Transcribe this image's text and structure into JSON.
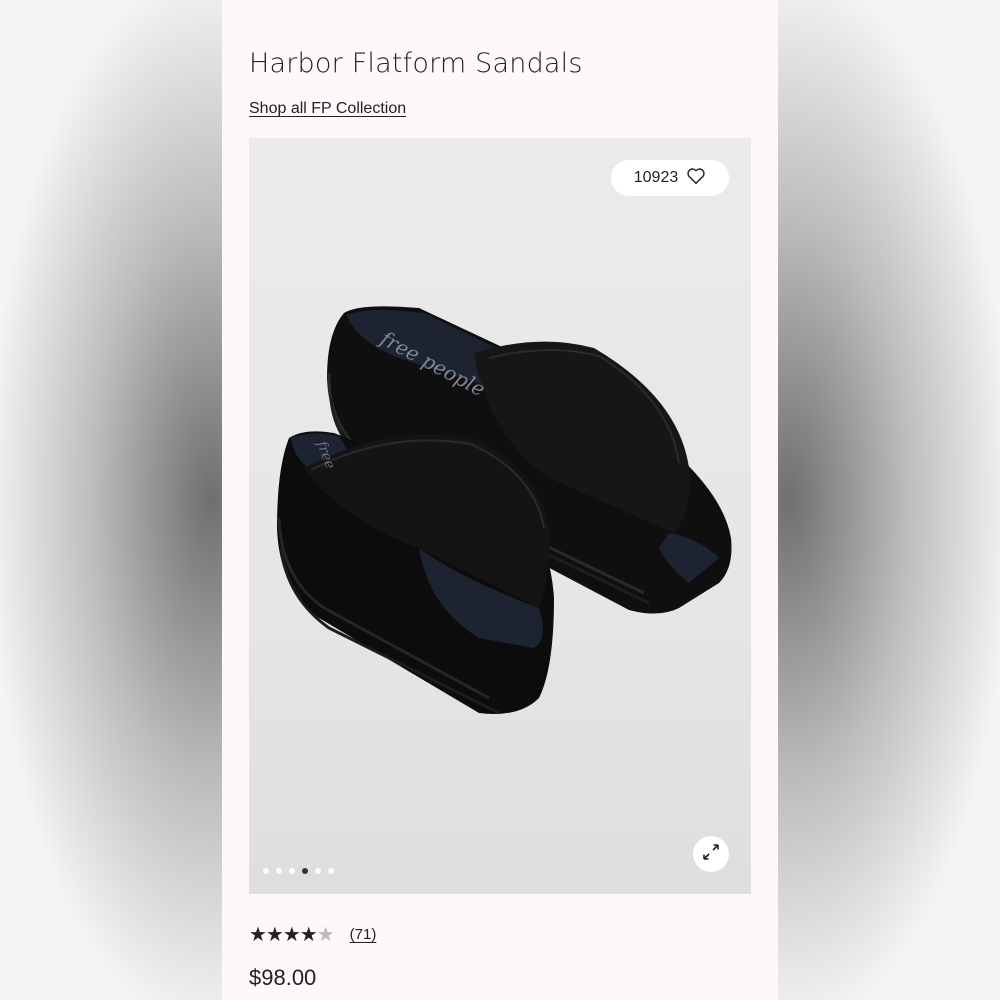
{
  "product": {
    "title": "Harbor Flatform Sandals",
    "collection_link": "Shop all FP Collection",
    "favorites_count": "10923",
    "rating": 4,
    "rating_max": 5,
    "review_count": "(71)",
    "price": "$98.00"
  },
  "gallery": {
    "total_images": 6,
    "active_index": 3,
    "brand_on_insole": "free people"
  },
  "icons": {
    "favorite": "heart-outline-icon",
    "expand": "expand-arrows-icon"
  }
}
